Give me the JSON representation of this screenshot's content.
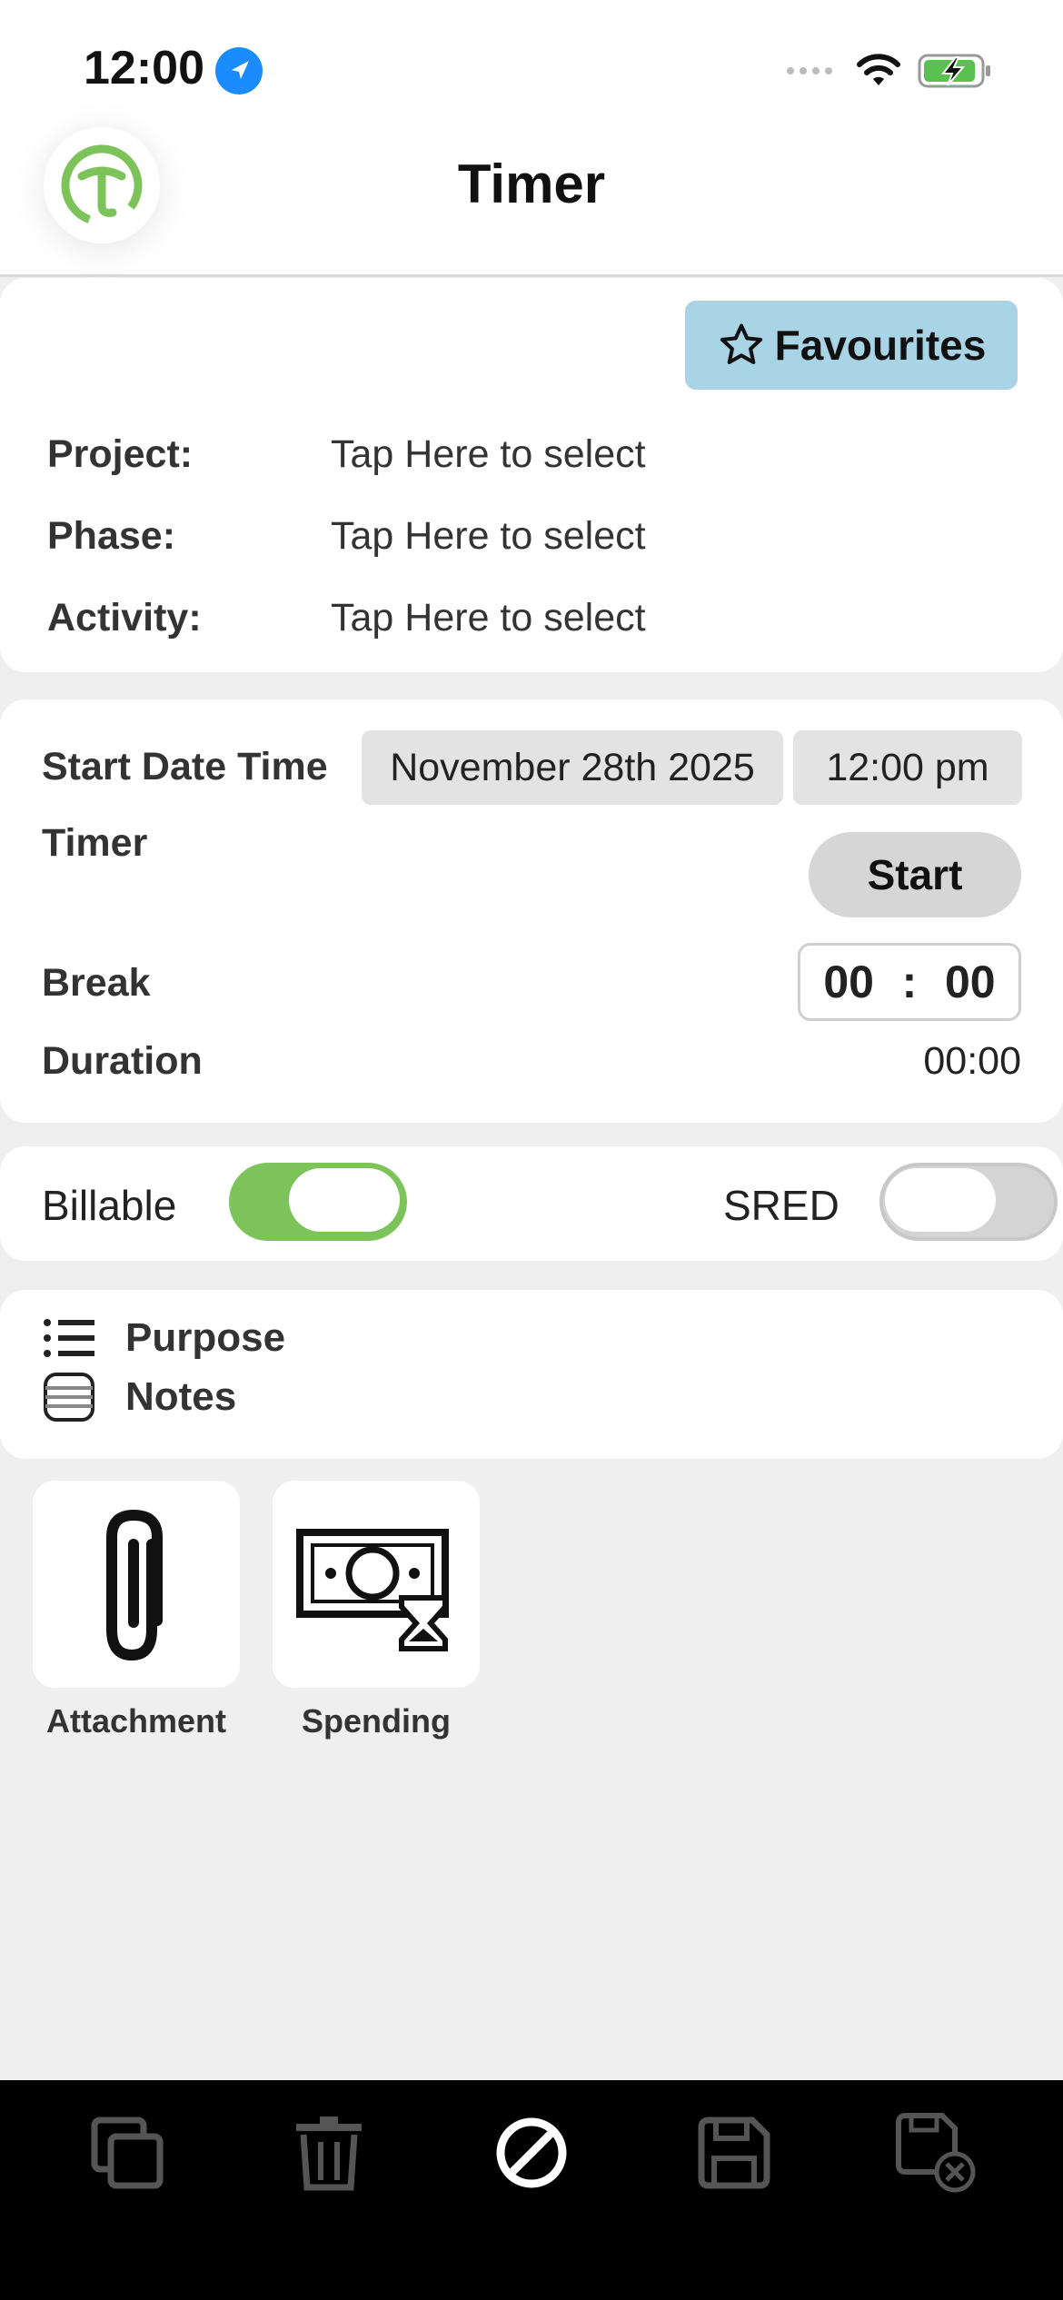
{
  "status_bar": {
    "time": "12:00"
  },
  "header": {
    "title": "Timer"
  },
  "selection": {
    "favourites_label": "Favourites",
    "project_label": "Project:",
    "project_value": "Tap Here to select",
    "phase_label": "Phase:",
    "phase_value": "Tap Here to select",
    "activity_label": "Activity:",
    "activity_value": "Tap Here to select"
  },
  "timing": {
    "start_label": "Start Date Time",
    "start_date": "November 28th 2025",
    "start_time": "12:00 pm",
    "timer_label": "Timer",
    "start_button": "Start",
    "break_label": "Break",
    "break_hours": "00",
    "break_sep": ":",
    "break_minutes": "00",
    "duration_label": "Duration",
    "duration_value": "00:00"
  },
  "flags": {
    "billable_label": "Billable",
    "billable_on": true,
    "sred_label": "SRED",
    "sred_on": false
  },
  "details": {
    "purpose_label": "Purpose",
    "notes_label": "Notes"
  },
  "tiles": [
    {
      "label": "Attachment",
      "icon": "paperclip-icon"
    },
    {
      "label": "Spending",
      "icon": "money-hourglass-icon"
    }
  ],
  "bottom_bar": [
    "copy-icon",
    "trash-icon",
    "cancel-icon",
    "save-icon",
    "discard-save-icon"
  ],
  "colors": {
    "accent_green": "#7cc35a",
    "favourites_bg": "#a9d4e6",
    "location": "#1a8cff"
  }
}
